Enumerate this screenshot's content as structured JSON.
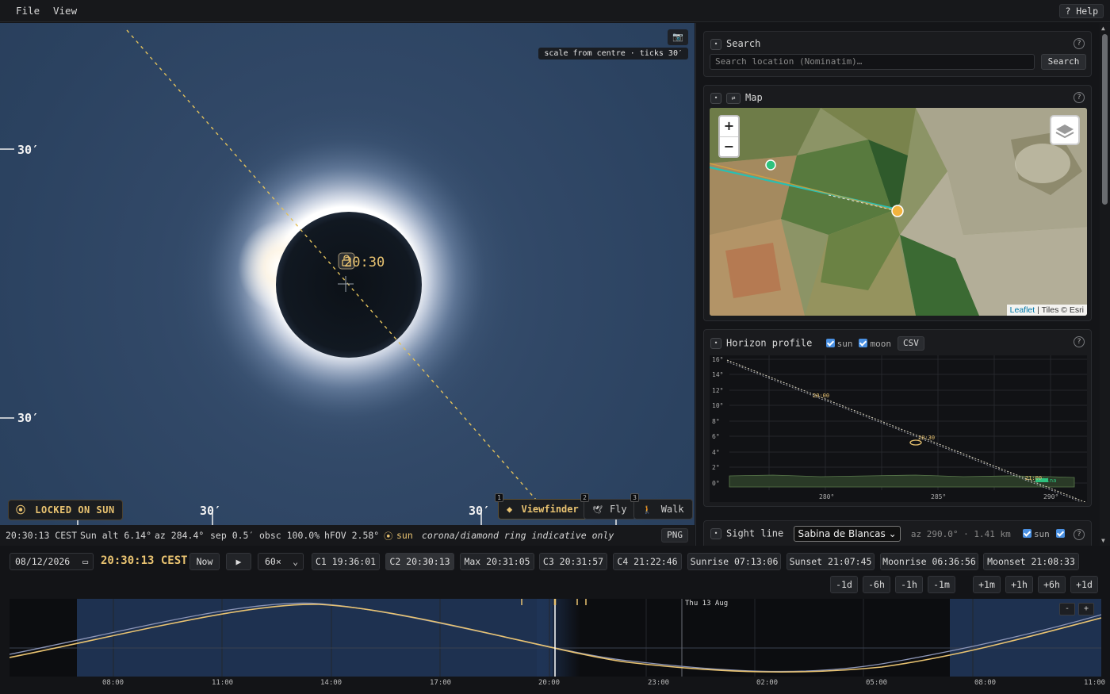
{
  "menu": {
    "file": "File",
    "view": "View",
    "help": "? Help"
  },
  "viewport": {
    "scale_label": "scale from centre · ticks 30′",
    "camera_icon": "camera-icon",
    "tick_label": "30′",
    "time_label": "20:30",
    "lock_label": "LOCKED ON SUN",
    "modes": [
      {
        "num": "1",
        "label": "Viewfinder",
        "icon": "◆"
      },
      {
        "num": "2",
        "label": "Fly",
        "icon": "🕊"
      },
      {
        "num": "3",
        "label": "Walk",
        "icon": "🚶"
      }
    ]
  },
  "status": {
    "time": "20:30:13 CEST",
    "sun_alt": "Sun alt 6.14°",
    "az": "az 284.4°",
    "sep": "sep 0.5′",
    "obsc": "obsc 100.0%",
    "hfov": "hFOV 2.58°",
    "target": "sun",
    "note": "corona/diamond ring indicative only",
    "png": "PNG"
  },
  "panel": {
    "search": {
      "title": "Search",
      "placeholder": "Search location (Nominatim)…",
      "button": "Search"
    },
    "map": {
      "title": "Map",
      "zoom_in": "+",
      "zoom_out": "−",
      "attr_link": "Leaflet",
      "attr_rest": "| Tiles © Esri"
    },
    "horizon": {
      "title": "Horizon profile",
      "sun_label": "sun",
      "moon_label": "moon",
      "csv": "CSV",
      "y_ticks": [
        "16°",
        "14°",
        "12°",
        "10°",
        "8°",
        "6°",
        "4°",
        "2°",
        "0°"
      ],
      "x_ticks": [
        "280°",
        "285°",
        "290°"
      ],
      "annotations": [
        "20:00",
        "20:30",
        "21:00",
        "Sabina"
      ]
    },
    "sight": {
      "title": "Sight line",
      "selected": "Sabina de Blancas",
      "info": "az 290.0° · 1.41 km",
      "sun_label": "sun",
      "moon_label": "moon"
    }
  },
  "controls": {
    "date": "08/12/2026",
    "time": "20:30:13 CEST",
    "now": "Now",
    "play": "▶",
    "speed": "60×",
    "events": [
      "C1 19:36:01",
      "C2 20:30:13",
      "Max 20:31:05",
      "C3 20:31:57",
      "C4 21:22:46",
      "Sunrise 07:13:06",
      "Sunset 21:07:45",
      "Moonrise 06:36:56",
      "Moonset 21:08:33"
    ],
    "steps": [
      "-1d",
      "-6h",
      "-1h",
      "-1m",
      "+1m",
      "+1h",
      "+6h",
      "+1d"
    ]
  },
  "timeline": {
    "day_label": "Thu 13 Aug",
    "axis": [
      "08:00",
      "11:00",
      "14:00",
      "17:00",
      "20:00",
      "23:00",
      "02:00",
      "05:00",
      "08:00",
      "11:00"
    ],
    "zoom_out": "-",
    "zoom_in": "+"
  },
  "colors": {
    "accent": "#e9c371",
    "sun_line": "#e9c371",
    "moon_line": "#8d96b8",
    "sky": "#2f4564"
  }
}
